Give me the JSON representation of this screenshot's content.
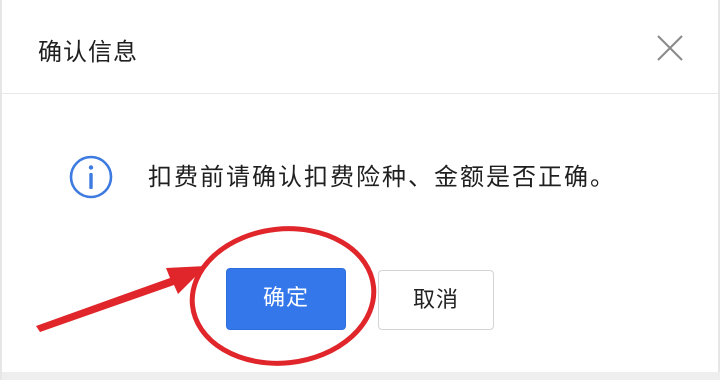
{
  "dialog": {
    "title": "确认信息",
    "close_icon": "close-icon",
    "message": "扣费前请确认扣费险种、金额是否正确。",
    "message_icon": "info-icon"
  },
  "buttons": {
    "confirm_label": "确定",
    "cancel_label": "取消"
  },
  "colors": {
    "primary": "#3477ea",
    "info": "#3d7be0",
    "annotation": "#e0262b"
  }
}
